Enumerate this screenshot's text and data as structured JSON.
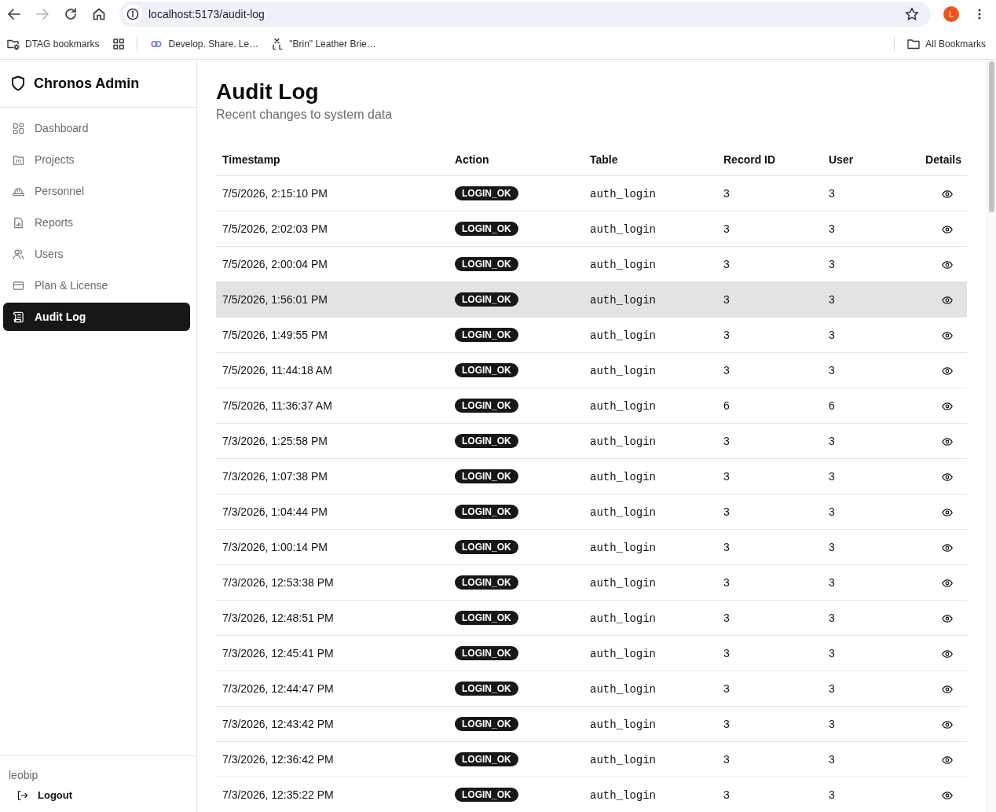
{
  "browser": {
    "nav_buttons": [
      {
        "kind": "back",
        "disabled": false
      },
      {
        "kind": "forward",
        "disabled": true
      },
      {
        "kind": "reload",
        "disabled": false
      },
      {
        "kind": "home",
        "disabled": false
      }
    ],
    "url": "localhost:5173/audit-log",
    "profile_initial": "L",
    "bookmarks": [
      {
        "kind": "managed",
        "label": "DTAG bookmarks"
      },
      {
        "kind": "apps"
      },
      {
        "kind": "page",
        "label": "Develop. Share. Le…"
      },
      {
        "kind": "shop",
        "label": "\"Brin\" Leather Brie…"
      }
    ],
    "all_bookmarks": "All Bookmarks"
  },
  "sidebar": {
    "brand": "Chronos Admin",
    "nav": [
      {
        "kind": "dashboard",
        "label": "Dashboard",
        "selected": false
      },
      {
        "kind": "projects",
        "label": "Projects",
        "selected": false
      },
      {
        "kind": "personnel",
        "label": "Personnel",
        "selected": false
      },
      {
        "kind": "reports",
        "label": "Reports",
        "selected": false
      },
      {
        "kind": "users",
        "label": "Users",
        "selected": false
      },
      {
        "kind": "plan",
        "label": "Plan & License",
        "selected": false
      },
      {
        "kind": "audit",
        "label": "Audit Log",
        "selected": true
      }
    ],
    "user": {
      "name": "leobip",
      "logout": "Logout"
    }
  },
  "page": {
    "title": "Audit Log",
    "subtitle": "Recent changes to system data",
    "table": {
      "columns": [
        "Timestamp",
        "Action",
        "Table",
        "Record ID",
        "User",
        "Details"
      ],
      "rows": [
        {
          "timestamp": "7/5/2026, 2:15:10 PM",
          "action": "LOGIN_OK",
          "table": "auth_login",
          "record_id": "3",
          "user": "3",
          "highlighted": false
        },
        {
          "timestamp": "7/5/2026, 2:02:03 PM",
          "action": "LOGIN_OK",
          "table": "auth_login",
          "record_id": "3",
          "user": "3",
          "highlighted": false
        },
        {
          "timestamp": "7/5/2026, 2:00:04 PM",
          "action": "LOGIN_OK",
          "table": "auth_login",
          "record_id": "3",
          "user": "3",
          "highlighted": false
        },
        {
          "timestamp": "7/5/2026, 1:56:01 PM",
          "action": "LOGIN_OK",
          "table": "auth_login",
          "record_id": "3",
          "user": "3",
          "highlighted": true
        },
        {
          "timestamp": "7/5/2026, 1:49:55 PM",
          "action": "LOGIN_OK",
          "table": "auth_login",
          "record_id": "3",
          "user": "3",
          "highlighted": false
        },
        {
          "timestamp": "7/5/2026, 11:44:18 AM",
          "action": "LOGIN_OK",
          "table": "auth_login",
          "record_id": "3",
          "user": "3",
          "highlighted": false
        },
        {
          "timestamp": "7/5/2026, 11:36:37 AM",
          "action": "LOGIN_OK",
          "table": "auth_login",
          "record_id": "6",
          "user": "6",
          "highlighted": false
        },
        {
          "timestamp": "7/3/2026, 1:25:58 PM",
          "action": "LOGIN_OK",
          "table": "auth_login",
          "record_id": "3",
          "user": "3",
          "highlighted": false
        },
        {
          "timestamp": "7/3/2026, 1:07:38 PM",
          "action": "LOGIN_OK",
          "table": "auth_login",
          "record_id": "3",
          "user": "3",
          "highlighted": false
        },
        {
          "timestamp": "7/3/2026, 1:04:44 PM",
          "action": "LOGIN_OK",
          "table": "auth_login",
          "record_id": "3",
          "user": "3",
          "highlighted": false
        },
        {
          "timestamp": "7/3/2026, 1:00:14 PM",
          "action": "LOGIN_OK",
          "table": "auth_login",
          "record_id": "3",
          "user": "3",
          "highlighted": false
        },
        {
          "timestamp": "7/3/2026, 12:53:38 PM",
          "action": "LOGIN_OK",
          "table": "auth_login",
          "record_id": "3",
          "user": "3",
          "highlighted": false
        },
        {
          "timestamp": "7/3/2026, 12:48:51 PM",
          "action": "LOGIN_OK",
          "table": "auth_login",
          "record_id": "3",
          "user": "3",
          "highlighted": false
        },
        {
          "timestamp": "7/3/2026, 12:45:41 PM",
          "action": "LOGIN_OK",
          "table": "auth_login",
          "record_id": "3",
          "user": "3",
          "highlighted": false
        },
        {
          "timestamp": "7/3/2026, 12:44:47 PM",
          "action": "LOGIN_OK",
          "table": "auth_login",
          "record_id": "3",
          "user": "3",
          "highlighted": false
        },
        {
          "timestamp": "7/3/2026, 12:43:42 PM",
          "action": "LOGIN_OK",
          "table": "auth_login",
          "record_id": "3",
          "user": "3",
          "highlighted": false
        },
        {
          "timestamp": "7/3/2026, 12:36:42 PM",
          "action": "LOGIN_OK",
          "table": "auth_login",
          "record_id": "3",
          "user": "3",
          "highlighted": false
        },
        {
          "timestamp": "7/3/2026, 12:35:22 PM",
          "action": "LOGIN_OK",
          "table": "auth_login",
          "record_id": "3",
          "user": "3",
          "highlighted": false
        }
      ]
    }
  }
}
